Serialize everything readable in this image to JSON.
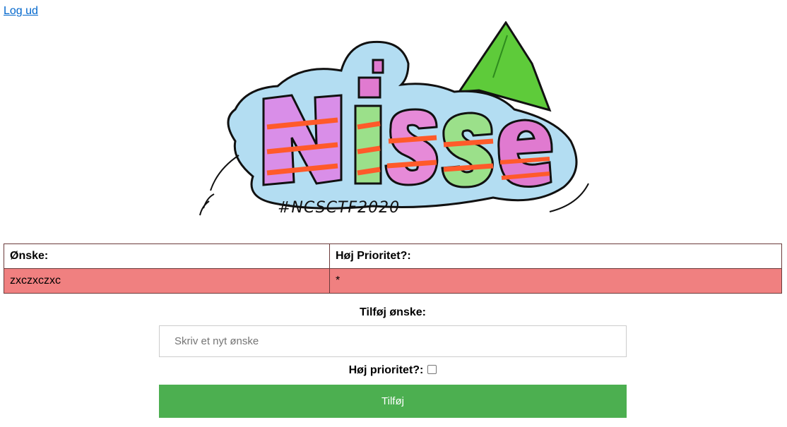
{
  "header": {
    "logout_label": "Log ud"
  },
  "logo": {
    "icon": "nisse-graffiti-logo",
    "tag_text": "#NCSCTF2020"
  },
  "wish_table": {
    "headers": [
      "Ønske:",
      "Høj Prioritet?:"
    ],
    "rows": [
      {
        "wish": "zxczxczxc",
        "priority": "*",
        "high_priority": true
      }
    ],
    "high_priority_color": "#f08080",
    "border_color": "#6b3b3b"
  },
  "add_form": {
    "title": "Tilføj ønske:",
    "wish_placeholder": "Skriv et nyt ønske",
    "wish_value": "",
    "priority_label": "Høj prioritet?:",
    "priority_checked": false,
    "submit_label": "Tilføj",
    "submit_color": "#4caf50"
  }
}
